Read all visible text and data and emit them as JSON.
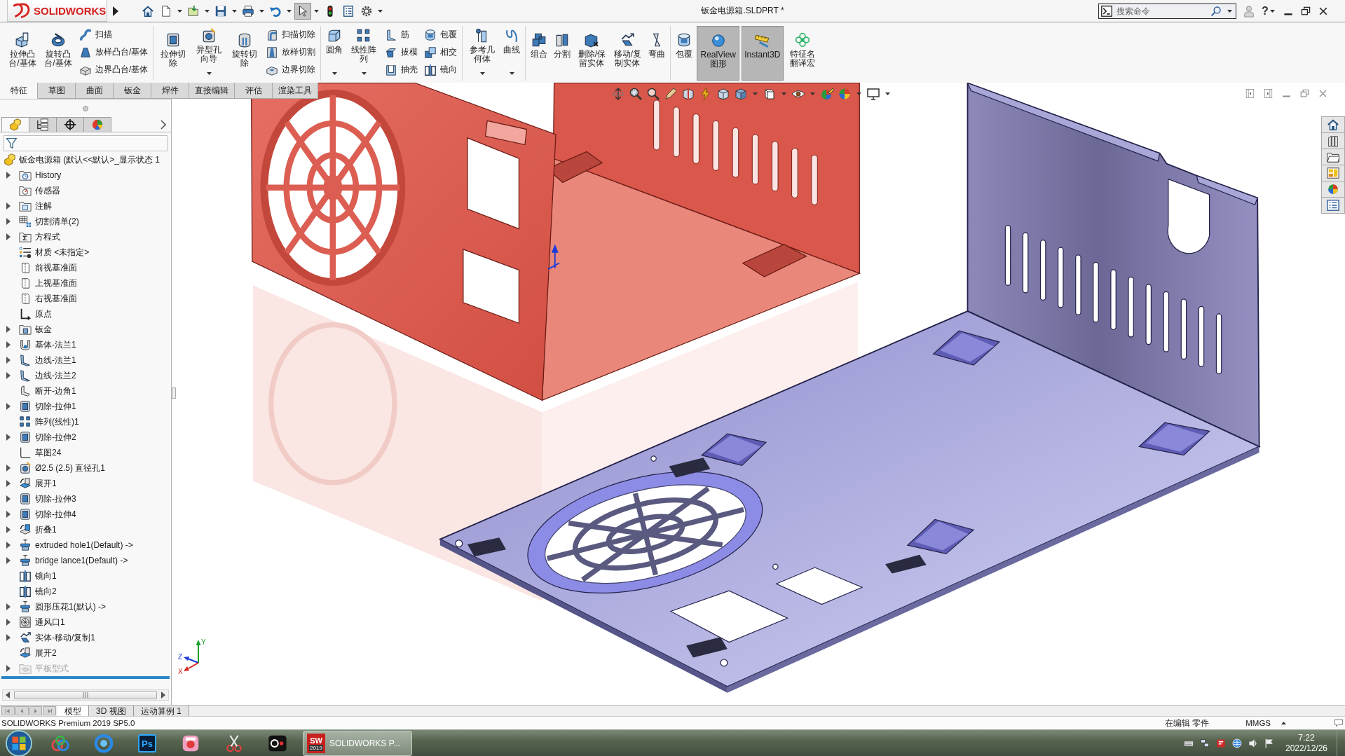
{
  "title_bar": {
    "logo": "SOLIDWORKS",
    "quick_access": [
      {
        "kind": "home",
        "menu": false,
        "selected": false
      },
      {
        "kind": "new",
        "menu": true,
        "selected": false
      },
      {
        "kind": "open",
        "menu": true,
        "selected": false
      },
      {
        "kind": "save",
        "menu": true,
        "selected": false
      },
      {
        "kind": "print",
        "menu": true,
        "selected": false
      },
      {
        "kind": "undo",
        "menu": true,
        "selected": false
      },
      {
        "kind": "select",
        "menu": true,
        "selected": true
      },
      {
        "kind": "rebuild",
        "menu": false,
        "selected": false
      },
      {
        "kind": "properties",
        "menu": false,
        "selected": false
      },
      {
        "kind": "options",
        "menu": true,
        "selected": false
      }
    ],
    "title": "钣金电源箱.SLDPRT *",
    "search": {
      "placeholder": "搜索命令"
    },
    "help": "?"
  },
  "ribbon": {
    "groups": [
      {
        "items": [
          {
            "label": "拉伸凸台/基体",
            "kind": "extrude",
            "menu": false,
            "selected": false
          },
          {
            "label": "旋转凸台/基体",
            "kind": "revolve",
            "menu": false,
            "selected": false
          },
          {
            "column": [
              {
                "label": "扫描",
                "kind": "sweep"
              },
              {
                "label": "放样凸台/基体",
                "kind": "loft"
              },
              {
                "label": "边界凸台/基体",
                "kind": "boundary"
              }
            ]
          }
        ]
      },
      {
        "items": [
          {
            "label": "拉伸切除",
            "kind": "cut",
            "menu": false,
            "selected": false
          },
          {
            "label": "异型孔向导",
            "kind": "hole",
            "menu": true,
            "selected": false
          },
          {
            "label": "旋转切除",
            "kind": "revcut",
            "menu": false,
            "selected": false
          },
          {
            "column": [
              {
                "label": "扫描切除",
                "kind": "sweepcut"
              },
              {
                "label": "放样切割",
                "kind": "loftcut"
              },
              {
                "label": "边界切除",
                "kind": "boundarycut"
              }
            ]
          }
        ]
      },
      {
        "items": [
          {
            "label": "圆角",
            "kind": "fillet",
            "menu": true,
            "selected": false
          },
          {
            "label": "线性阵列",
            "kind": "pattern",
            "menu": true,
            "selected": false
          },
          {
            "column": [
              {
                "label": "筋",
                "kind": "rib"
              },
              {
                "label": "拔模",
                "kind": "draft"
              },
              {
                "label": "抽壳",
                "kind": "shell"
              }
            ]
          },
          {
            "column": [
              {
                "label": "包覆",
                "kind": "wrap"
              },
              {
                "label": "相交",
                "kind": "intersect"
              },
              {
                "label": "镜向",
                "kind": "mirror"
              }
            ]
          }
        ]
      },
      {
        "items": [
          {
            "label": "参考几何体",
            "kind": "refgeom",
            "menu": true,
            "selected": false
          },
          {
            "label": "曲线",
            "kind": "curve",
            "menu": true,
            "selected": false
          }
        ]
      },
      {
        "items": [
          {
            "label": "组合",
            "kind": "combine",
            "menu": false,
            "selected": false
          },
          {
            "label": "分割",
            "kind": "split",
            "menu": false,
            "selected": false
          },
          {
            "label": "删除/保留实体",
            "kind": "delete",
            "menu": false,
            "selected": false
          },
          {
            "label": "移动/复制实体",
            "kind": "move",
            "menu": false,
            "selected": false
          },
          {
            "label": "弯曲",
            "kind": "flex",
            "menu": false,
            "selected": false
          }
        ]
      },
      {
        "items": [
          {
            "label": "包覆",
            "kind": "wrap",
            "menu": false,
            "selected": false
          },
          {
            "label": "RealView 图形",
            "kind": "realview",
            "menu": false,
            "selected": true
          },
          {
            "label": "Instant3D",
            "kind": "instant3d",
            "menu": false,
            "selected": true
          },
          {
            "label": "特征名翻译宏",
            "kind": "macro",
            "menu": false,
            "selected": false
          }
        ]
      }
    ]
  },
  "command_tabs": [
    {
      "label": "特征",
      "selected": true
    },
    {
      "label": "草图",
      "selected": false
    },
    {
      "label": "曲面",
      "selected": false
    },
    {
      "label": "钣金",
      "selected": false
    },
    {
      "label": "焊件",
      "selected": false
    },
    {
      "label": "直接编辑",
      "selected": false
    },
    {
      "label": "评估",
      "selected": false
    },
    {
      "label": "渲染工具",
      "selected": false
    }
  ],
  "feature_panel": {
    "tabs": [
      {
        "kind": "feature",
        "selected": true
      },
      {
        "kind": "property",
        "selected": false
      },
      {
        "kind": "config",
        "selected": false
      },
      {
        "kind": "display",
        "selected": false
      }
    ],
    "tree": {
      "root": {
        "label": "钣金电源箱 (默认<<默认>_显示状态 1",
        "kind": "part"
      },
      "items": [
        {
          "label": "History",
          "kind": "history",
          "expandable": true,
          "disabled": false
        },
        {
          "label": "传感器",
          "kind": "sensor",
          "expandable": false,
          "disabled": false
        },
        {
          "label": "注解",
          "kind": "annotation",
          "expandable": true,
          "disabled": false
        },
        {
          "label": "切割清单(2)",
          "kind": "cutlist",
          "expandable": true,
          "disabled": false
        },
        {
          "label": "方程式",
          "kind": "equation",
          "expandable": true,
          "disabled": false
        },
        {
          "label": "材质 <未指定>",
          "kind": "material",
          "expandable": false,
          "disabled": false
        },
        {
          "label": "前视基准面",
          "kind": "plane",
          "expandable": false,
          "disabled": false
        },
        {
          "label": "上视基准面",
          "kind": "plane",
          "expandable": false,
          "disabled": false
        },
        {
          "label": "右视基准面",
          "kind": "plane",
          "expandable": false,
          "disabled": false
        },
        {
          "label": "原点",
          "kind": "origin",
          "expandable": false,
          "disabled": false
        },
        {
          "label": "钣金",
          "kind": "sheetmetal",
          "expandable": true,
          "disabled": false
        },
        {
          "label": "基体-法兰1",
          "kind": "flange",
          "expandable": true,
          "disabled": false
        },
        {
          "label": "边线-法兰1",
          "kind": "edgeflange",
          "expandable": true,
          "disabled": false
        },
        {
          "label": "边线-法兰2",
          "kind": "edgeflange",
          "expandable": true,
          "disabled": false
        },
        {
          "label": "断开-边角1",
          "kind": "corner",
          "expandable": false,
          "disabled": false
        },
        {
          "label": "切除-拉伸1",
          "kind": "cut",
          "expandable": true,
          "disabled": false
        },
        {
          "label": "阵列(线性)1",
          "kind": "pattern",
          "expandable": false,
          "disabled": false
        },
        {
          "label": "切除-拉伸2",
          "kind": "cut",
          "expandable": true,
          "disabled": false
        },
        {
          "label": "草图24",
          "kind": "sketch",
          "expandable": false,
          "disabled": false
        },
        {
          "label": "Ø2.5 (2.5) 直径孔1",
          "kind": "hole",
          "expandable": true,
          "disabled": false
        },
        {
          "label": "展开1",
          "kind": "unfold",
          "expandable": true,
          "disabled": false
        },
        {
          "label": "切除-拉伸3",
          "kind": "cut",
          "expandable": true,
          "disabled": false
        },
        {
          "label": "切除-拉伸4",
          "kind": "cut",
          "expandable": true,
          "disabled": false
        },
        {
          "label": "折叠1",
          "kind": "fold",
          "expandable": true,
          "disabled": false
        },
        {
          "label": "extruded hole1(Default) ->",
          "kind": "library",
          "expandable": true,
          "disabled": false
        },
        {
          "label": "bridge lance1(Default) ->",
          "kind": "library",
          "expandable": true,
          "disabled": false
        },
        {
          "label": "镜向1",
          "kind": "mirror",
          "expandable": false,
          "disabled": false
        },
        {
          "label": "镜向2",
          "kind": "mirror",
          "expandable": false,
          "disabled": false
        },
        {
          "label": "圆形压花1(默认) ->",
          "kind": "library",
          "expandable": true,
          "disabled": false
        },
        {
          "label": "通风口1",
          "kind": "vent",
          "expandable": true,
          "disabled": false
        },
        {
          "label": "实体-移动/复制1",
          "kind": "move",
          "expandable": true,
          "disabled": false
        },
        {
          "label": "展开2",
          "kind": "unfold",
          "expandable": false,
          "disabled": false
        },
        {
          "label": "平板型式",
          "kind": "flatpattern",
          "expandable": true,
          "disabled": true
        }
      ]
    }
  },
  "graphics": {
    "view_toolbar": [
      {
        "kind": "zoomfit",
        "menu": false
      },
      {
        "kind": "zoomarea",
        "menu": false
      },
      {
        "kind": "zoomin",
        "menu": false
      },
      {
        "kind": "previous",
        "menu": false
      },
      {
        "kind": "section",
        "menu": false
      },
      {
        "kind": "annotation",
        "menu": false
      },
      {
        "kind": "orientation",
        "menu": false
      },
      {
        "kind": "display",
        "menu": true
      },
      {
        "kind": "hide",
        "menu": true
      },
      {
        "kind": "visibility",
        "menu": true
      },
      {
        "kind": "appearance",
        "menu": false
      },
      {
        "kind": "scene",
        "menu": true
      },
      {
        "kind": "settings",
        "menu": true
      }
    ],
    "triad": {
      "x": "X",
      "y": "Y",
      "z": "Z"
    }
  },
  "bottom_tabs": [
    {
      "label": "模型",
      "selected": true
    },
    {
      "label": "3D 视图",
      "selected": false
    },
    {
      "label": "运动算例 1",
      "selected": false
    }
  ],
  "status_bar": {
    "product": "SOLIDWORKS Premium 2019 SP5.0",
    "mode": "在编辑 零件",
    "units": "MMGS"
  },
  "taskbar": {
    "apps": [
      {
        "kind": "cloud"
      },
      {
        "kind": "browser"
      },
      {
        "kind": "editor",
        "text": "Ps"
      },
      {
        "kind": "gallery"
      },
      {
        "kind": "scissors"
      },
      {
        "kind": "recorder"
      }
    ],
    "window": {
      "icon_text": "SW",
      "icon_badge": "2019",
      "label": "SOLIDWORKS P..."
    },
    "time": "7:22",
    "date": "2022/12/26"
  }
}
